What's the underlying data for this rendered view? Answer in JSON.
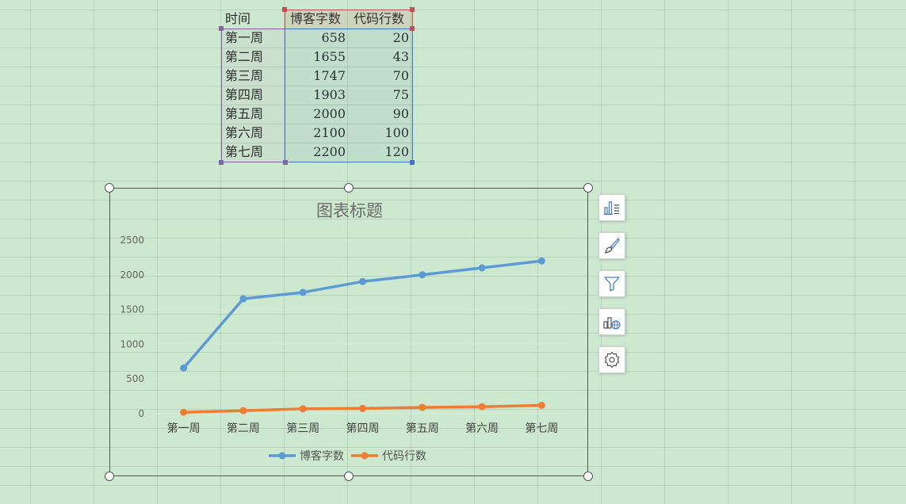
{
  "table": {
    "headers": [
      "时间",
      "博客字数",
      "代码行数"
    ],
    "rows": [
      [
        "第一周",
        "658",
        "20"
      ],
      [
        "第二周",
        "1655",
        "43"
      ],
      [
        "第三周",
        "1747",
        "70"
      ],
      [
        "第四周",
        "1903",
        "75"
      ],
      [
        "第五周",
        "2000",
        "90"
      ],
      [
        "第六周",
        "2100",
        "100"
      ],
      [
        "第七周",
        "2200",
        "120"
      ]
    ]
  },
  "chart_data": {
    "type": "line",
    "title": "图表标题",
    "categories": [
      "第一周",
      "第二周",
      "第三周",
      "第四周",
      "第五周",
      "第六周",
      "第七周"
    ],
    "series": [
      {
        "name": "博客字数",
        "color": "#5b9bd5",
        "values": [
          658,
          1655,
          1747,
          1903,
          2000,
          2100,
          2200
        ]
      },
      {
        "name": "代码行数",
        "color": "#ed7d31",
        "values": [
          20,
          43,
          70,
          75,
          90,
          100,
          120
        ]
      }
    ],
    "ylim": [
      0,
      2500
    ],
    "yticks": [
      "0",
      "500",
      "1000",
      "1500",
      "2000",
      "2500"
    ],
    "grid": true,
    "legend_position": "bottom"
  },
  "side_toolbar": {
    "buttons": [
      {
        "icon": "chart-elements-icon"
      },
      {
        "icon": "chart-style-brush-icon"
      },
      {
        "icon": "chart-filter-icon"
      },
      {
        "icon": "online-chart-icon"
      },
      {
        "icon": "chart-settings-gear-icon"
      }
    ]
  },
  "colors": {
    "sheet_background": "#cce8cf",
    "header_selection": "#c0504d",
    "category_selection": "#8064a2",
    "value_selection": "#4472c4"
  }
}
